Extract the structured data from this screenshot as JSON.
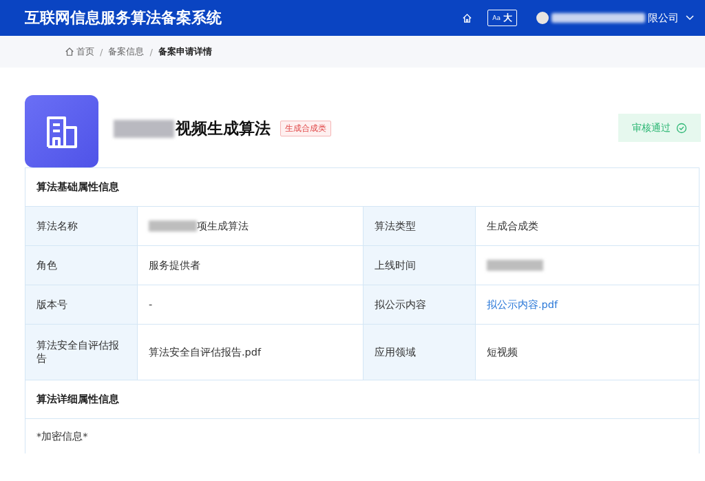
{
  "header": {
    "title": "互联网信息服务算法备案系统",
    "font_size_button": {
      "small": "Aa",
      "large": "大"
    },
    "company": {
      "redacted": true,
      "visible_text": "限公司"
    }
  },
  "breadcrumb": [
    {
      "label": "首页",
      "kind": "home"
    },
    {
      "separator": "/",
      "label": "备案信息",
      "kind": "link"
    },
    {
      "separator": "/",
      "label": "备案申请详情",
      "kind": "current"
    }
  ],
  "algorithm": {
    "name_redacted": true,
    "name_visible": "视频生成算法",
    "tag": "生成合成类",
    "status": "审核通过"
  },
  "sections": [
    {
      "title": "算法基础属性信息",
      "rows": [
        [
          {
            "label": "算法名称",
            "value": "项生成算法",
            "kind": "text",
            "redacted": true
          },
          {
            "label": "算法类型",
            "value": "生成合成类",
            "kind": "text"
          }
        ],
        [
          {
            "label": "角色",
            "value": "服务提供者",
            "kind": "text"
          },
          {
            "label": "上线时间",
            "kind": "redacted",
            "redacted": true
          }
        ],
        [
          {
            "label": "版本号",
            "value": "-",
            "kind": "text"
          },
          {
            "label": "拟公示内容",
            "value": "拟公示内容.pdf",
            "kind": "link"
          }
        ],
        [
          {
            "label": "算法安全自评估报告",
            "value": "算法安全自评估报告.pdf",
            "kind": "text"
          },
          {
            "label": "应用领域",
            "value": "短视频",
            "kind": "text"
          }
        ]
      ]
    },
    {
      "title": "算法详细属性信息",
      "note": "*加密信息*"
    }
  ]
}
